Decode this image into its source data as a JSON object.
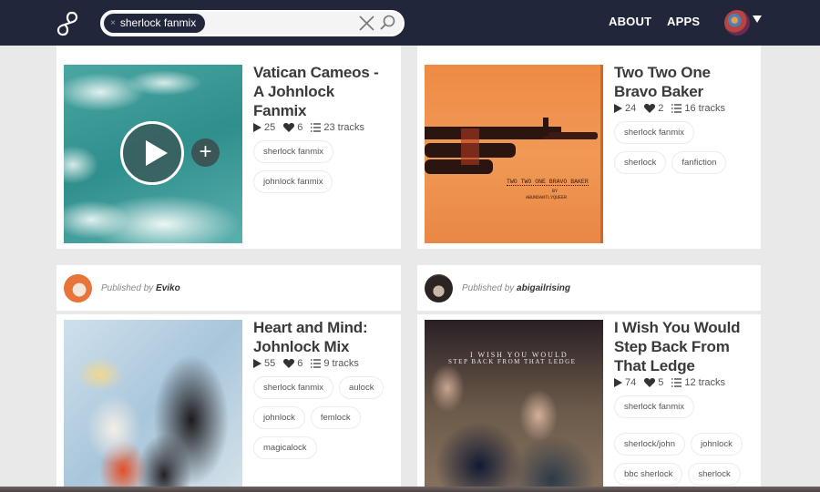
{
  "header": {
    "logo_icon": "infinity-logo-icon",
    "search": {
      "chip_label": "sherlock fanmix",
      "chip_remove": "×",
      "query": "",
      "clear_icon": "close-icon",
      "search_icon": "search-icon"
    },
    "nav": [
      {
        "label": "ABOUT"
      },
      {
        "label": "APPS"
      }
    ],
    "user_menu_icon": "caret-down-icon"
  },
  "mixes": [
    {
      "title": "Vatican Cameos - A Johnlock Fanmix",
      "plays": "25",
      "likes": "6",
      "tracks": "23 tracks",
      "tags": [
        "sherlock fanmix",
        "johnlock fanmix"
      ],
      "cover": "Cherry blossoms over teal water",
      "hover_play": true
    },
    {
      "title": "Two Two One Bravo Baker",
      "plays": "24",
      "likes": "2",
      "tracks": "16 tracks",
      "tags": [
        "sherlock fanmix",
        "sherlock",
        "fanfiction"
      ],
      "cover_text": [
        "TWO TWO ONE BRAVO BAKER",
        "BY",
        "ABUNDANTLYQUEER"
      ]
    },
    {
      "publisher_prefix": "Published by",
      "publisher": "Eviko",
      "title": "Heart and Mind: Johnlock Mix",
      "plays": "55",
      "likes": "6",
      "tracks": "9 tracks",
      "tags": [
        "sherlock fanmix",
        "aulock",
        "johnlock",
        "femlock",
        "magicalock"
      ],
      "cover": "Illustration of two people kissing"
    },
    {
      "publisher_prefix": "Published by",
      "publisher": "abigailrising",
      "title": "I Wish You Would Step Back From That Ledge",
      "plays": "74",
      "likes": "5",
      "tracks": "12 tracks",
      "tags": [
        "sherlock fanmix",
        "sherlock/john",
        "johnlock",
        "bbc sherlock",
        "sherlock"
      ],
      "cover_text": [
        "I WISH YOU WOULD",
        "STEP BACK FROM THAT LEDGE"
      ]
    }
  ],
  "colors": {
    "header_bg": "#22263a",
    "page_bg": "#e9e9e9",
    "card_bg": "#ffffff",
    "title_text": "#3a3a3a"
  }
}
